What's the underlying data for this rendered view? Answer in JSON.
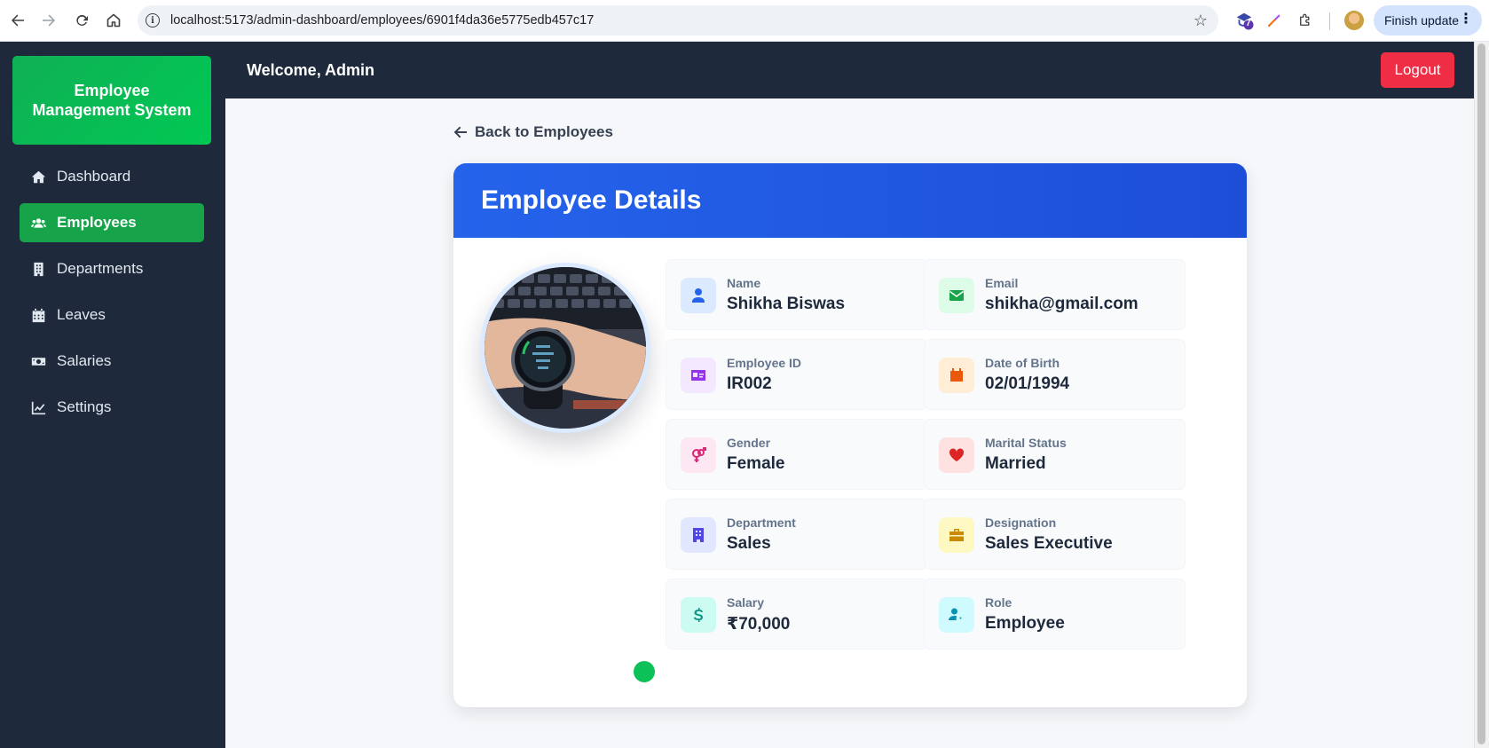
{
  "browser": {
    "url": "localhost:5173/admin-dashboard/employees/6901f4da36e5775edb457c17",
    "extension_badge": "7",
    "finish_update_label": "Finish update"
  },
  "sidebar": {
    "brand": "Employee Management System",
    "items": [
      {
        "label": "Dashboard",
        "icon": "home-icon",
        "active": false
      },
      {
        "label": "Employees",
        "icon": "users-icon",
        "active": true
      },
      {
        "label": "Departments",
        "icon": "building-icon",
        "active": false
      },
      {
        "label": "Leaves",
        "icon": "calendar-icon",
        "active": false
      },
      {
        "label": "Salaries",
        "icon": "money-icon",
        "active": false
      },
      {
        "label": "Settings",
        "icon": "chart-line-icon",
        "active": false
      }
    ]
  },
  "topbar": {
    "welcome": "Welcome, Admin",
    "logout_label": "Logout"
  },
  "main": {
    "back_label": "Back to Employees",
    "card_title": "Employee Details",
    "fields": [
      {
        "label": "Name",
        "value": "Shikha Biswas",
        "icon": "user-icon",
        "color": "#2563eb",
        "bg": "#dbeafe"
      },
      {
        "label": "Email",
        "value": "shikha@gmail.com",
        "icon": "envelope-icon",
        "color": "#16a34a",
        "bg": "#dcfce7"
      },
      {
        "label": "Employee ID",
        "value": "IR002",
        "icon": "id-card-icon",
        "color": "#9333ea",
        "bg": "#f3e8ff"
      },
      {
        "label": "Date of Birth",
        "value": "02/01/1994",
        "icon": "calendar-icon",
        "color": "#ea580c",
        "bg": "#ffedd5"
      },
      {
        "label": "Gender",
        "value": "Female",
        "icon": "venus-mars-icon",
        "color": "#db2777",
        "bg": "#fce7f3"
      },
      {
        "label": "Marital Status",
        "value": "Married",
        "icon": "heart-icon",
        "color": "#dc2626",
        "bg": "#fee2e2"
      },
      {
        "label": "Department",
        "value": "Sales",
        "icon": "building-icon",
        "color": "#4f46e5",
        "bg": "#e0e7ff"
      },
      {
        "label": "Designation",
        "value": "Sales Executive",
        "icon": "briefcase-icon",
        "color": "#ca8a04",
        "bg": "#fef9c3"
      },
      {
        "label": "Salary",
        "value": "₹70,000",
        "icon": "dollar-icon",
        "color": "#0d9488",
        "bg": "#ccfbf1"
      },
      {
        "label": "Role",
        "value": "Employee",
        "icon": "user-gear-icon",
        "color": "#0891b2",
        "bg": "#cffafe"
      }
    ]
  }
}
